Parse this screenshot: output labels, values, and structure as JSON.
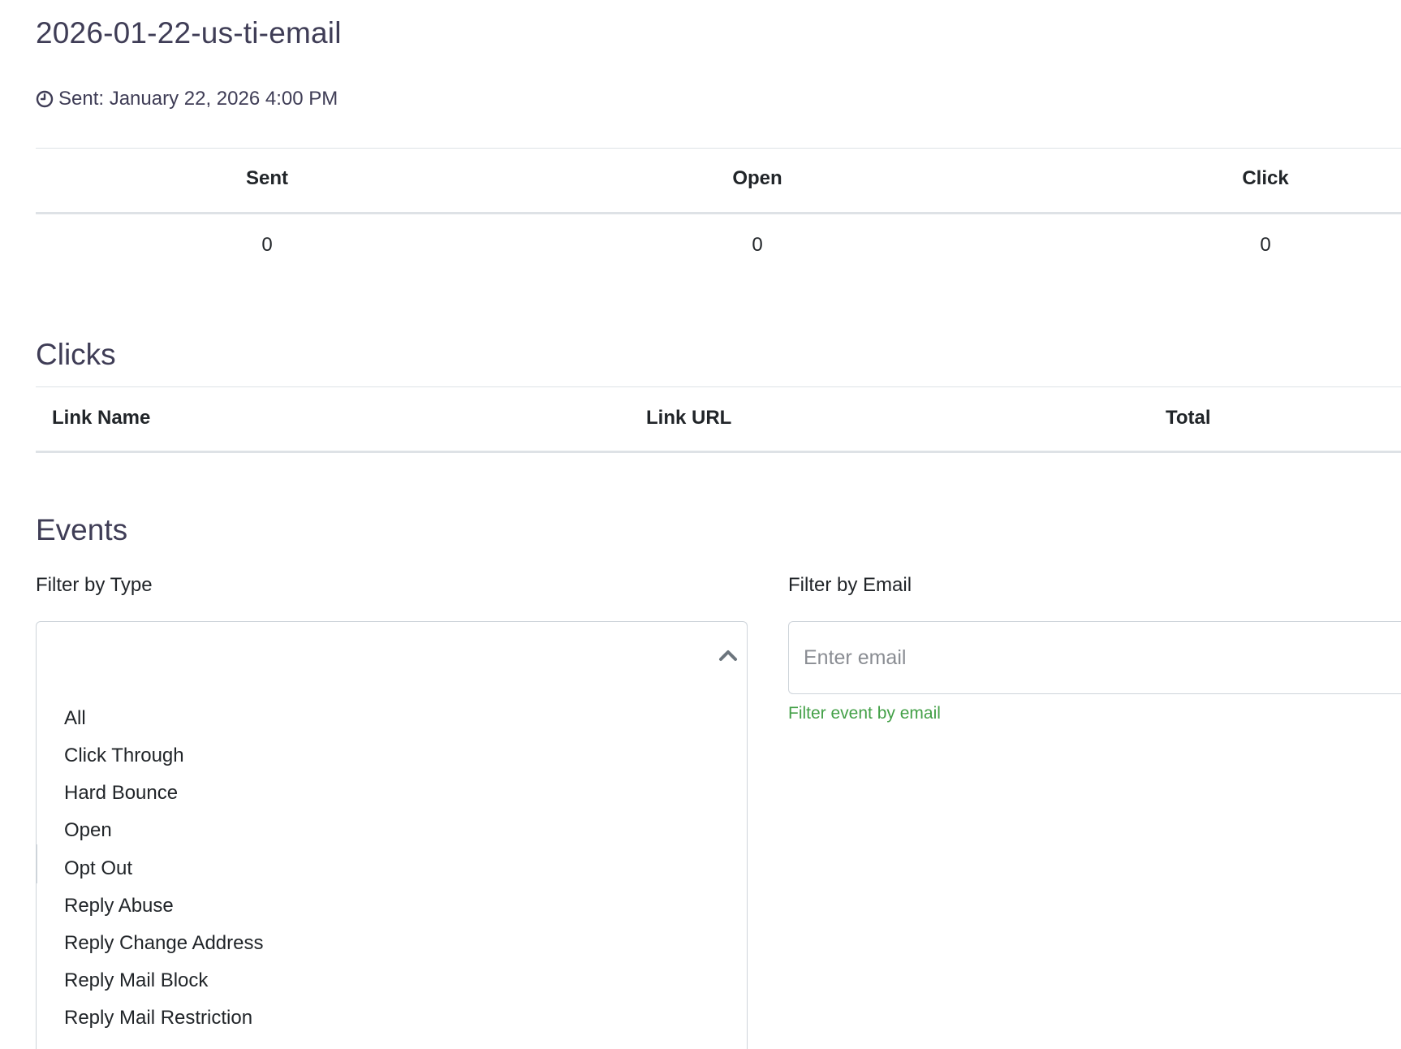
{
  "header": {
    "title": "2026-01-22-us-ti-email",
    "sent_text": "Sent: January 22, 2026 4:00 PM",
    "clock_icon": "clock-icon"
  },
  "stats": {
    "columns": [
      "Sent",
      "Open",
      "Click"
    ],
    "values": [
      "0",
      "0",
      "0"
    ]
  },
  "clicks": {
    "title": "Clicks",
    "columns": [
      "Link Name",
      "Link URL",
      "Total"
    ]
  },
  "events": {
    "title": "Events",
    "filter_type": {
      "label": "Filter by Type",
      "selected": "",
      "caret_icon": "chevron-up-icon",
      "options": [
        "All",
        "Click Through",
        "Hard Bounce",
        "Open",
        "Opt Out",
        "Reply Abuse",
        "Reply Change Address",
        "Reply Mail Block",
        "Reply Mail Restriction"
      ]
    },
    "filter_email": {
      "label": "Filter by Email",
      "placeholder": "Enter email",
      "value": "",
      "help": "Filter event by email"
    }
  },
  "colors": {
    "heading": "#3f3d56",
    "text": "#212529",
    "border": "#dee2e6",
    "help_green": "#43a047",
    "placeholder": "#8a8d93"
  }
}
